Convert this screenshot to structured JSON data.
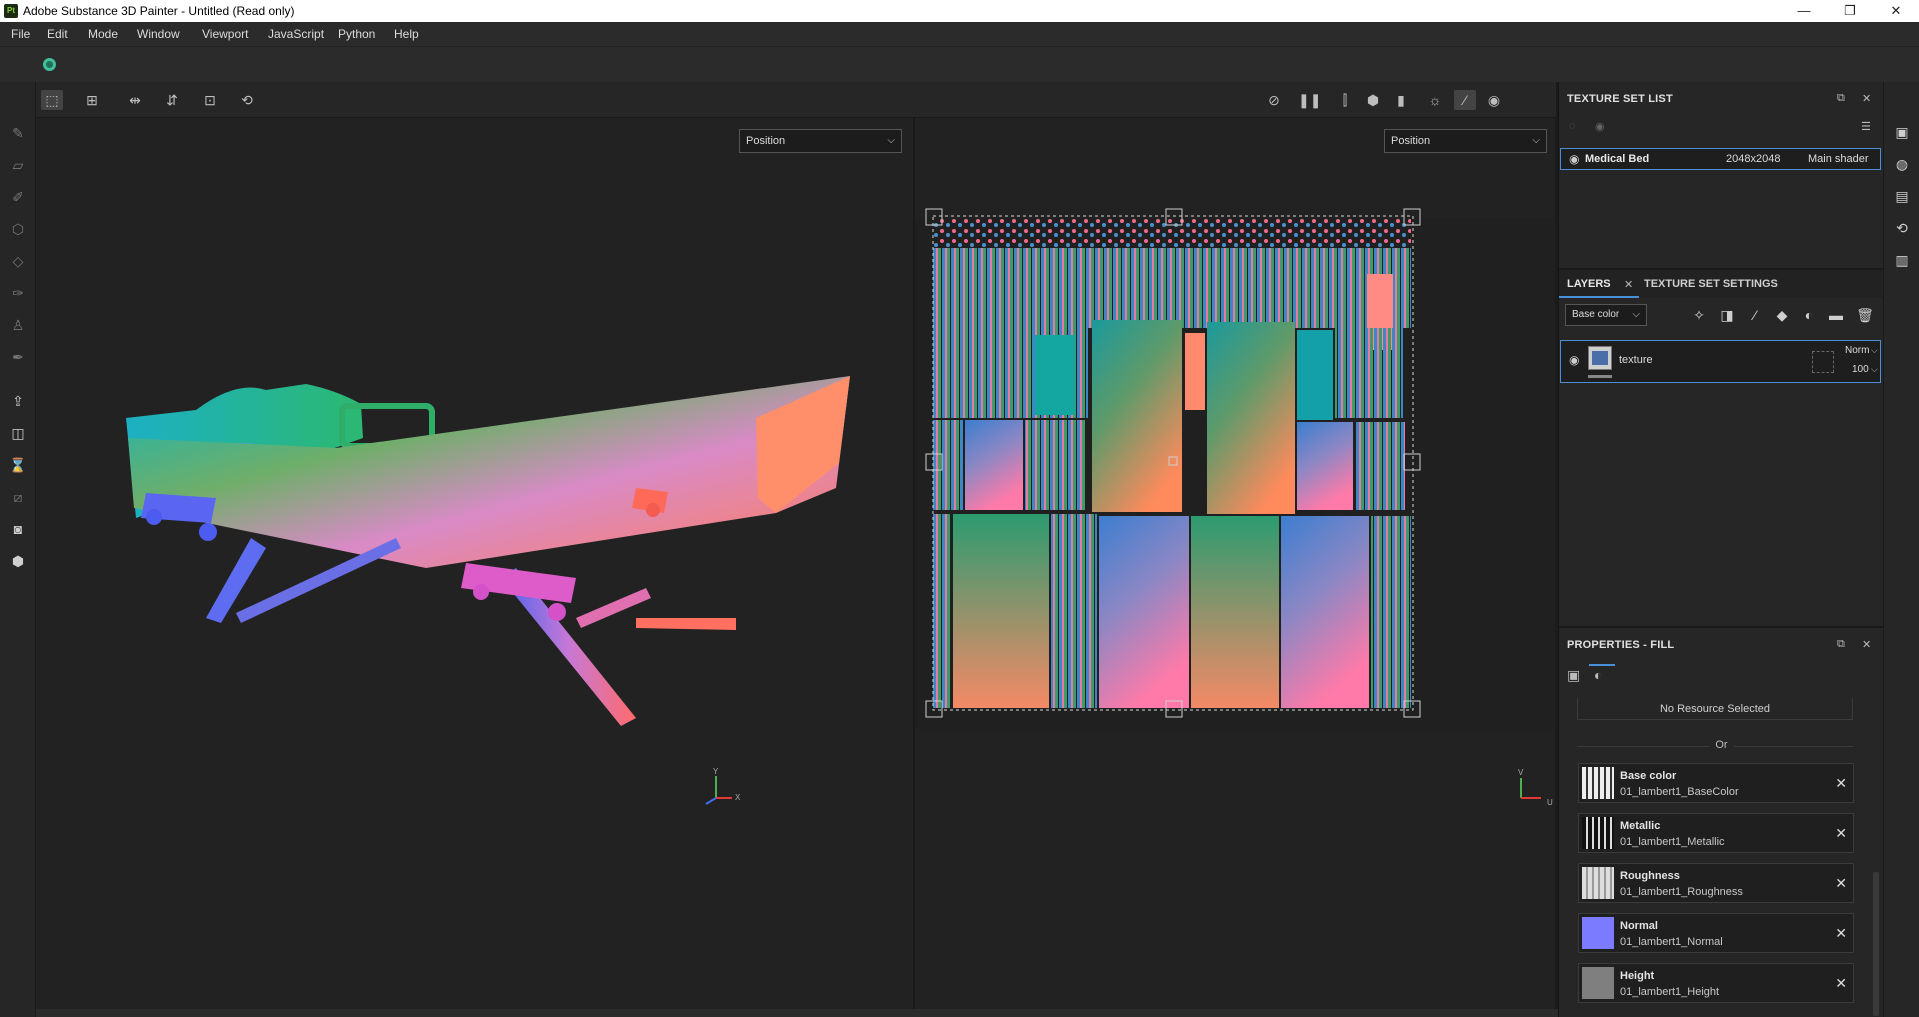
{
  "window": {
    "app_icon": "Pt",
    "title": "Adobe Substance 3D Painter - Untitled (Read only)",
    "minimize": "—",
    "restore": "❐",
    "close": "✕"
  },
  "menu": [
    "File",
    "Edit",
    "Mode",
    "Window",
    "Viewport",
    "JavaScript",
    "Python",
    "Help"
  ],
  "viewport": {
    "left_mode": "Position",
    "right_mode": "Position",
    "axis_left": {
      "y": "Y",
      "x": "X"
    },
    "axis_right": {
      "v": "V",
      "u": "U"
    }
  },
  "texture_set_list": {
    "title": "TEXTURE SET LIST",
    "item": {
      "name": "Medical Bed",
      "resolution": "2048x2048",
      "shader": "Main shader"
    }
  },
  "layers": {
    "tab_layers": "LAYERS",
    "tab_settings": "TEXTURE SET SETTINGS",
    "channel_select": "Base color",
    "layer": {
      "name": "texture",
      "blend": "Norm",
      "opacity": "100"
    }
  },
  "properties": {
    "title": "PROPERTIES - FILL",
    "no_resource": "No Resource Selected",
    "or_label": "Or",
    "channels": [
      {
        "name": "Base color",
        "file": "01_lambert1_BaseColor",
        "color": "#8a8a8a"
      },
      {
        "name": "Metallic",
        "file": "01_lambert1_Metallic",
        "color": "#2a2a2a"
      },
      {
        "name": "Roughness",
        "file": "01_lambert1_Roughness",
        "color": "#bdbdbd"
      },
      {
        "name": "Normal",
        "file": "01_lambert1_Normal",
        "color": "#7b7bff"
      },
      {
        "name": "Height",
        "file": "01_lambert1_Height",
        "color": "#7f7f7f"
      }
    ]
  },
  "colors": {
    "selection": "#4a90d9",
    "accent_teal": "#3fbf9c"
  }
}
